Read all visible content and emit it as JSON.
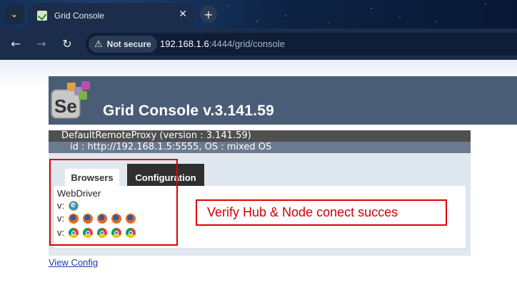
{
  "browser": {
    "tab_title": "Grid Console",
    "secure_label": "Not secure",
    "url_host": "192.168.1.6",
    "url_rest": ":4444/grid/console"
  },
  "page": {
    "logo_text": "Se",
    "title": "Grid Console v.3.141.59",
    "proxy_title": "DefaultRemoteProxy (version : 3.141.59)",
    "proxy_id": "id : http://192.168.1.5:5555, OS : mixed OS",
    "tabs": {
      "browsers": "Browsers",
      "configuration": "Configuration"
    },
    "webdriver_label": "WebDriver",
    "rows": [
      {
        "prefix": "v:",
        "browser": "internet-explorer",
        "count": 1
      },
      {
        "prefix": "v:",
        "browser": "firefox",
        "count": 5
      },
      {
        "prefix": "v:",
        "browser": "chrome",
        "count": 5
      }
    ],
    "annotation": "Verify Hub & Node conect succes",
    "view_config": "View Config"
  },
  "colors": {
    "header_bg": "#4a5d77",
    "annotation": "#e00000",
    "link": "#1a3da8"
  }
}
